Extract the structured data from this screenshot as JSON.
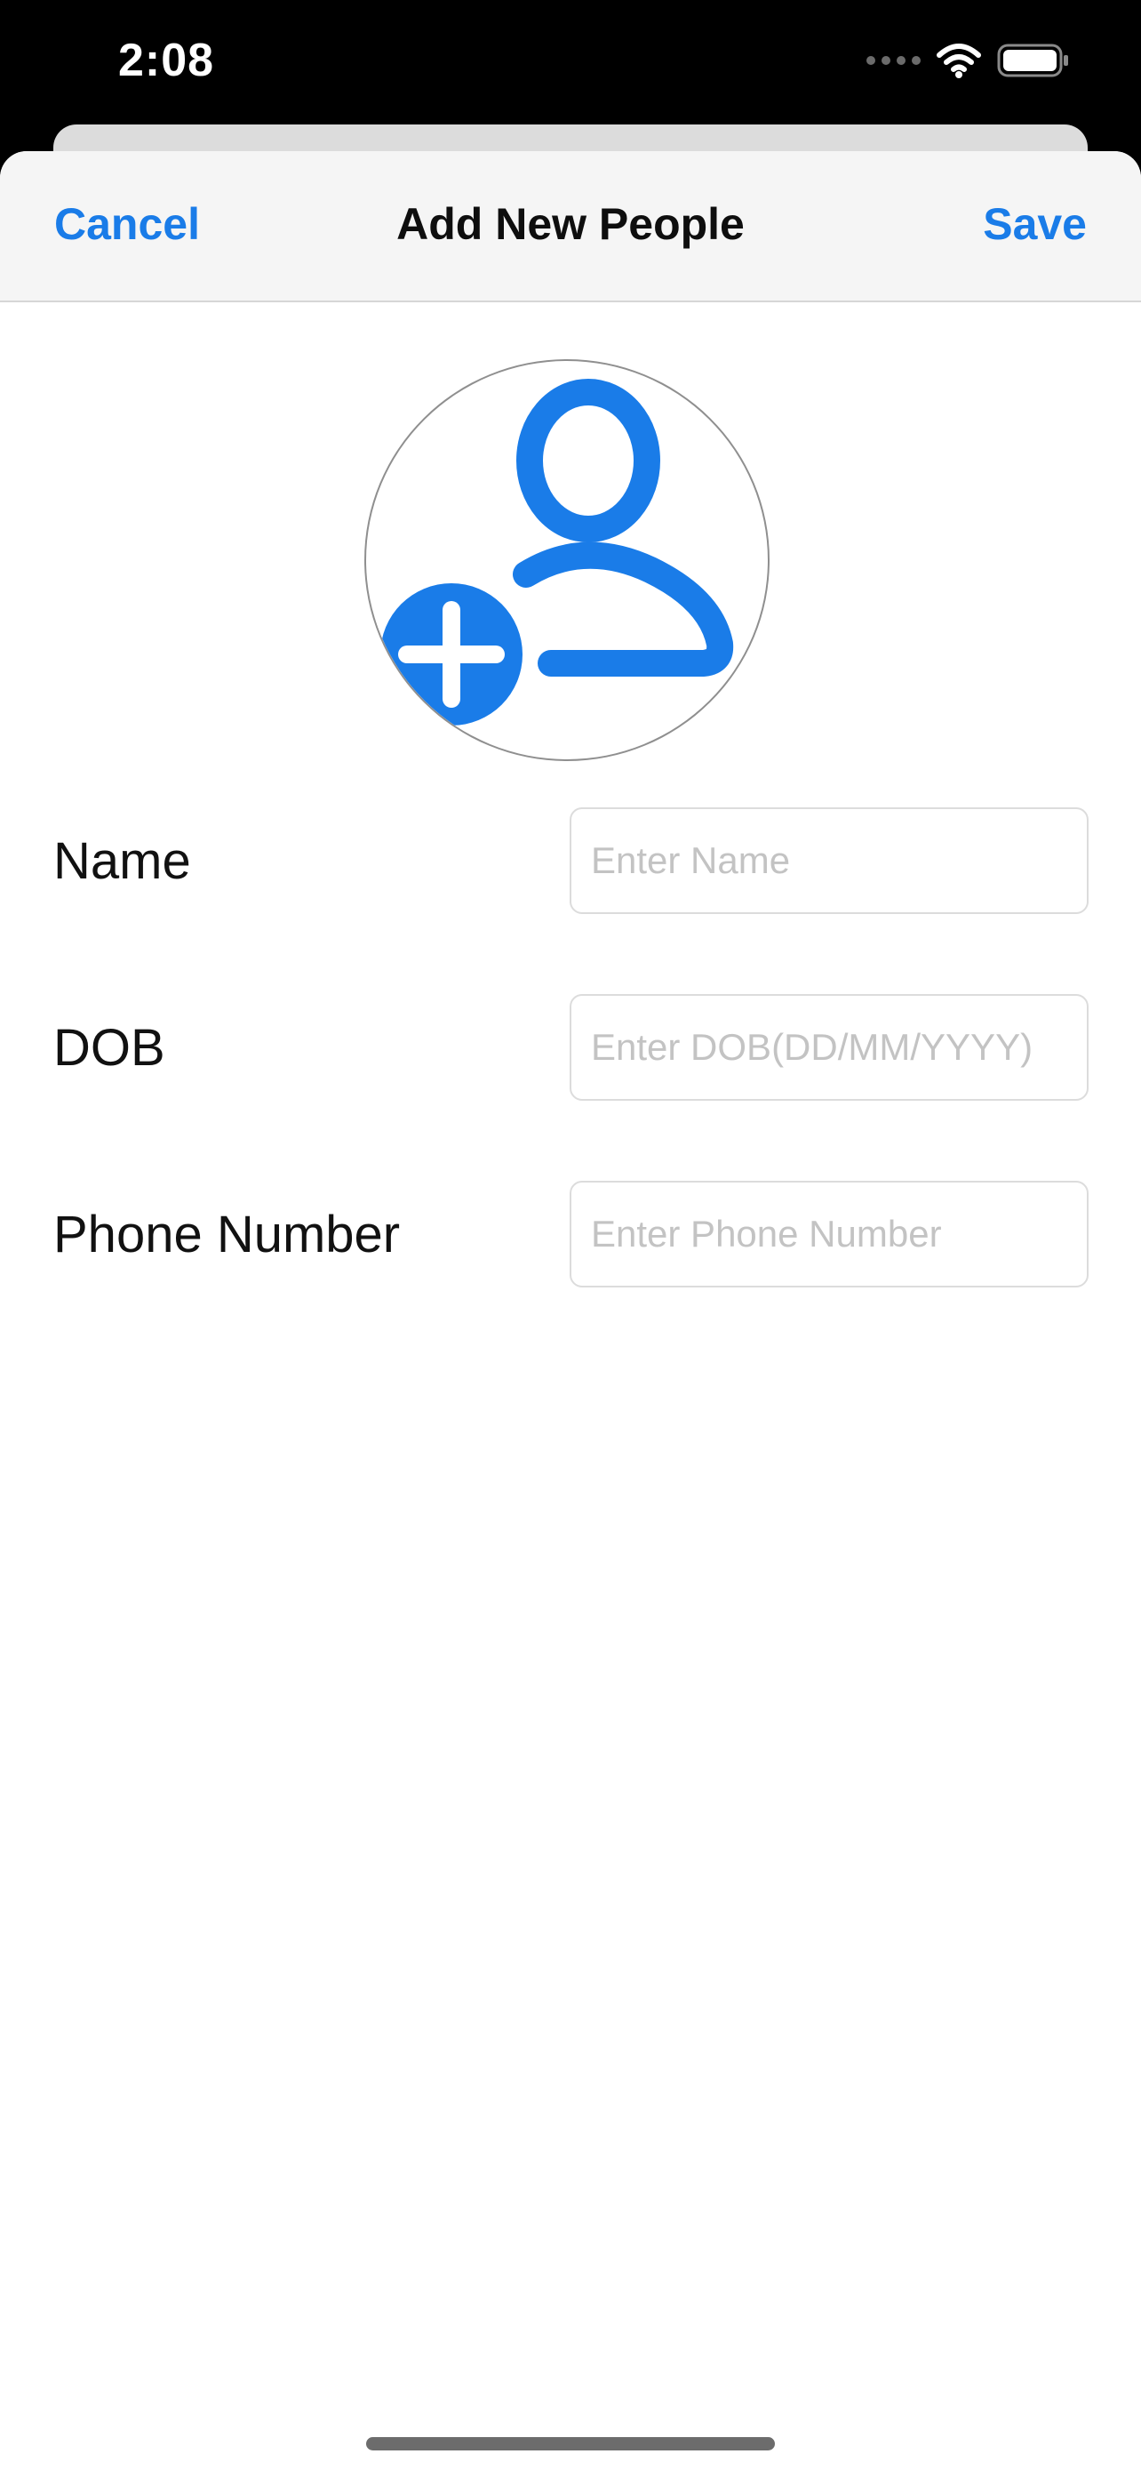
{
  "status_bar": {
    "time": "2:08",
    "icons": [
      "cellular-signal-icon",
      "wifi-icon",
      "battery-icon"
    ]
  },
  "nav": {
    "cancel_label": "Cancel",
    "title": "Add New People",
    "save_label": "Save"
  },
  "avatar": {
    "icon": "person-add-icon"
  },
  "form": {
    "fields": [
      {
        "label": "Name",
        "placeholder": "Enter Name",
        "value": ""
      },
      {
        "label": "DOB",
        "placeholder": "Enter DOB(DD/MM/YYYY)",
        "value": ""
      },
      {
        "label": "Phone Number",
        "placeholder": "Enter Phone Number",
        "value": ""
      }
    ]
  },
  "colors": {
    "accent": "#1a7ce8",
    "title_text": "#0e0e0e",
    "placeholder": "#c3c3c3",
    "nav_background": "#f5f5f5"
  }
}
